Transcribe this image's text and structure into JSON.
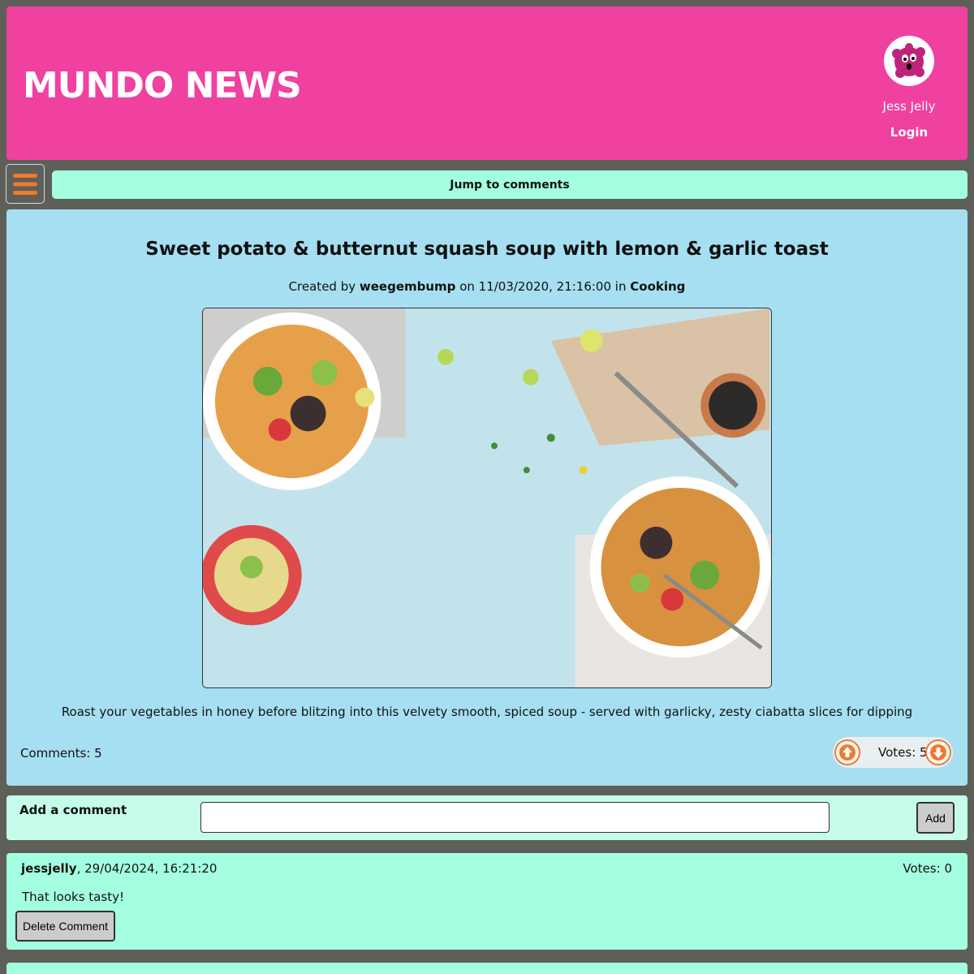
{
  "header": {
    "site_title": "MUNDO NEWS",
    "user_name": "Jess Jelly",
    "login_label": "Login"
  },
  "nav": {
    "jump_label": "Jump to comments"
  },
  "article": {
    "title": "Sweet potato & butternut squash soup with lemon & garlic toast",
    "meta_prefix": "Created by",
    "author": "weegembump",
    "meta_on": "on 11/03/2020, 21:16:00 in",
    "topic": "Cooking",
    "description": "Roast your vegetables in honey before blitzing into this velvety smooth, spiced soup - served with garlicky, zesty ciabatta slices for dipping",
    "comments_label": "Comments: 5",
    "votes_label": "Votes: 5"
  },
  "add_comment": {
    "label": "Add a comment",
    "input_value": "",
    "button_label": "Add"
  },
  "comments": [
    {
      "author": "jessjelly",
      "date": ", 29/04/2024, 16:21:20",
      "votes_label": "Votes: 0",
      "body": "That looks tasty!",
      "delete_label": "Delete Comment"
    }
  ],
  "colors": {
    "header": "#f040a0",
    "accent": "#f07a2e",
    "jump": "#a4ffe0",
    "article_bg": "#a6dff2"
  }
}
